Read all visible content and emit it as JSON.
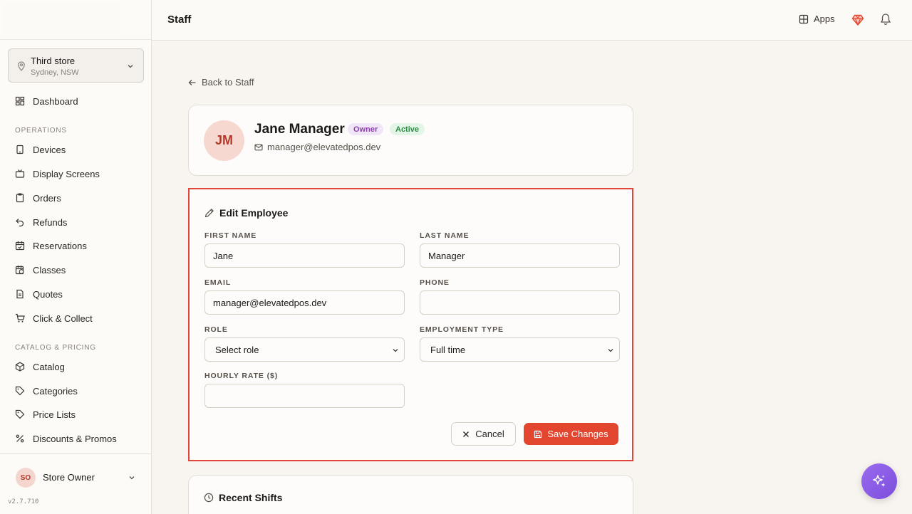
{
  "header": {
    "title": "Staff",
    "apps_label": "Apps",
    "icons": [
      "grid-icon",
      "gem-icon",
      "bell-icon"
    ]
  },
  "sidebar": {
    "store": {
      "name": "Third store",
      "location": "Sydney, NSW"
    },
    "dashboard": "Dashboard",
    "sections": [
      {
        "title": "OPERATIONS",
        "items": [
          {
            "label": "Devices",
            "icon": "tablet-icon"
          },
          {
            "label": "Display Screens",
            "icon": "tv-icon"
          },
          {
            "label": "Orders",
            "icon": "clipboard-icon"
          },
          {
            "label": "Refunds",
            "icon": "undo-icon"
          },
          {
            "label": "Reservations",
            "icon": "calendar-icon"
          },
          {
            "label": "Classes",
            "icon": "calendar-clock-icon"
          },
          {
            "label": "Quotes",
            "icon": "document-icon"
          },
          {
            "label": "Click & Collect",
            "icon": "cart-icon"
          }
        ]
      },
      {
        "title": "CATALOG & PRICING",
        "items": [
          {
            "label": "Catalog",
            "icon": "box-icon"
          },
          {
            "label": "Categories",
            "icon": "tag-icon"
          },
          {
            "label": "Price Lists",
            "icon": "tag-icon"
          },
          {
            "label": "Discounts & Promos",
            "icon": "percent-icon"
          }
        ]
      }
    ],
    "user": {
      "initials": "SO",
      "name": "Store Owner"
    },
    "version": "v2.7.710"
  },
  "main": {
    "back_label": "Back to Staff",
    "profile": {
      "initials": "JM",
      "name": "Jane Manager",
      "role_badge": "Owner",
      "status_badge": "Active",
      "email": "manager@elevatedpos.dev"
    },
    "edit_form": {
      "title": "Edit Employee",
      "first_name": {
        "label": "FIRST NAME",
        "value": "Jane"
      },
      "last_name": {
        "label": "LAST NAME",
        "value": "Manager"
      },
      "email": {
        "label": "EMAIL",
        "value": "manager@elevatedpos.dev"
      },
      "phone": {
        "label": "PHONE",
        "value": ""
      },
      "role": {
        "label": "ROLE",
        "value": "Select role"
      },
      "employment_type": {
        "label": "EMPLOYMENT TYPE",
        "value": "Full time"
      },
      "hourly_rate": {
        "label": "HOURLY RATE ($)",
        "value": ""
      },
      "cancel_label": "Cancel",
      "save_label": "Save Changes"
    },
    "recent_shifts_title": "Recent Shifts"
  },
  "colors": {
    "accent": "#e3462f",
    "highlight_border": "#e0463a",
    "ai_button": "#8b5ce6",
    "owner_badge": "#8e3fae",
    "active_badge": "#2f8a46"
  }
}
